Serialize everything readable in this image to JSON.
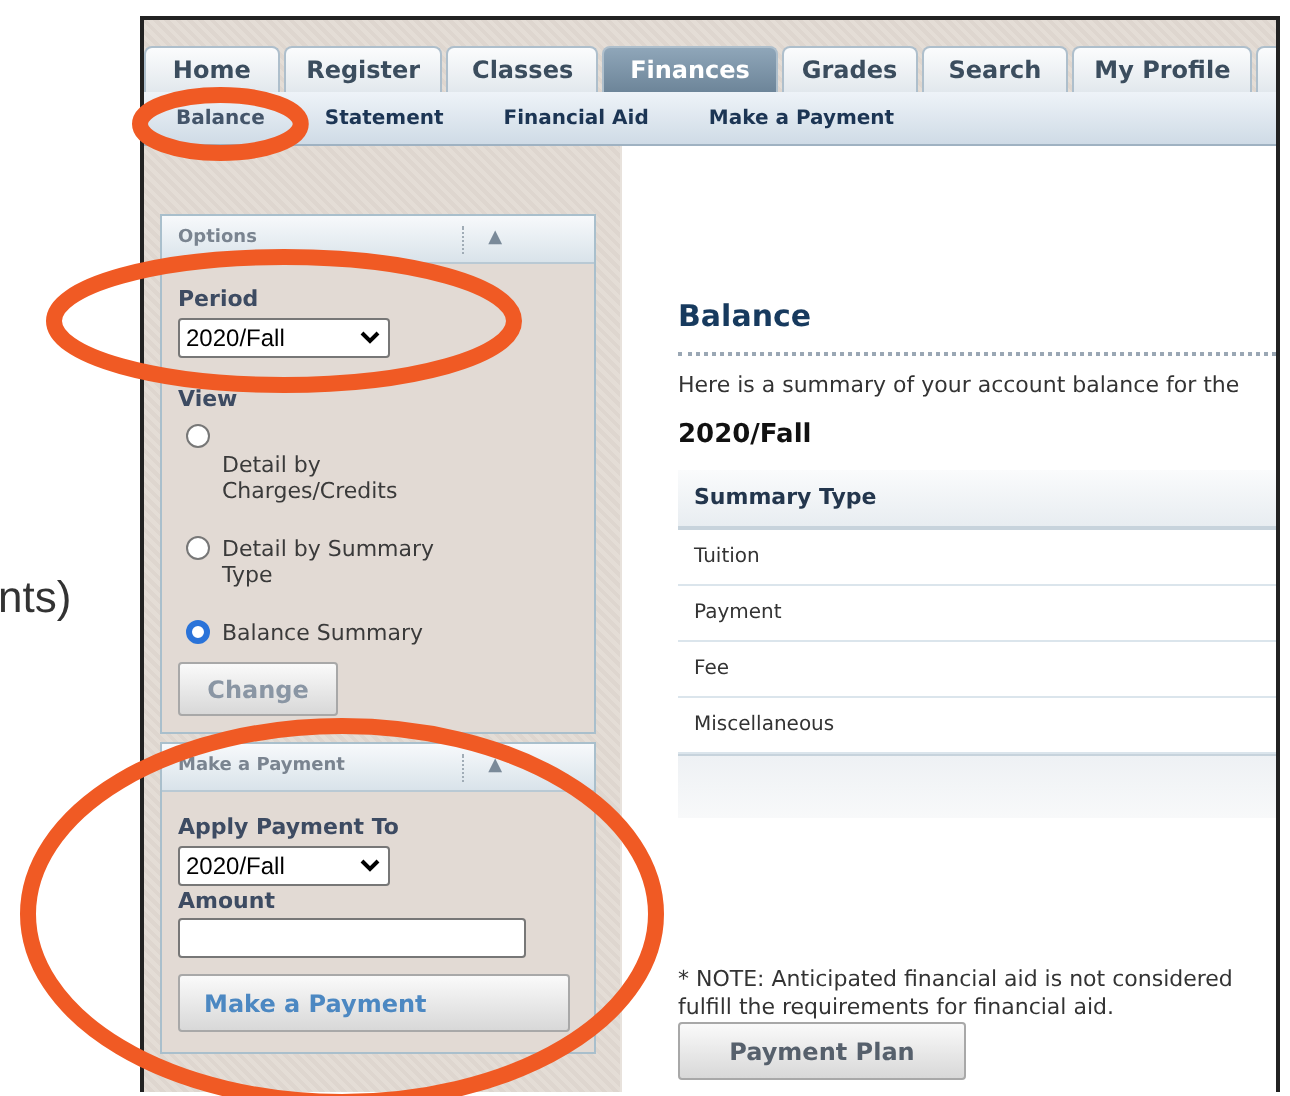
{
  "side_text": "nts)",
  "tabs": [
    {
      "label": "Home",
      "selected": false
    },
    {
      "label": "Register",
      "selected": false
    },
    {
      "label": "Classes",
      "selected": false
    },
    {
      "label": "Finances",
      "selected": true
    },
    {
      "label": "Grades",
      "selected": false
    },
    {
      "label": "Search",
      "selected": false
    },
    {
      "label": "My Profile",
      "selected": false
    }
  ],
  "subnav": [
    {
      "label": "Balance",
      "selected": true,
      "circled": true
    },
    {
      "label": "Statement",
      "selected": false,
      "circled": false
    },
    {
      "label": "Financial Aid",
      "selected": false,
      "circled": false
    },
    {
      "label": "Make a Payment",
      "selected": false,
      "circled": false
    }
  ],
  "options_panel": {
    "title": "Options",
    "collapse": "▲",
    "period_label": "Period",
    "period_value": "2020/Fall",
    "period_circled": true,
    "view_label": "View",
    "views": [
      {
        "label": "Detail by Charges/Credits",
        "selected": false
      },
      {
        "label": "Detail by Summary Type",
        "selected": false
      },
      {
        "label": "Balance Summary",
        "selected": true
      }
    ],
    "button": "Change"
  },
  "payment_panel": {
    "title": "Make a Payment",
    "collapse": "▲",
    "circled": true,
    "apply_label": "Apply Payment To",
    "apply_value": "2020/Fall",
    "amount_label": "Amount",
    "button": "Make a Payment"
  },
  "main": {
    "heading": "Balance",
    "intro": "Here is a summary of your account balance for the",
    "period": "2020/Fall",
    "table": {
      "columns": [
        "Summary Type"
      ],
      "rows": [
        [
          "Tuition"
        ],
        [
          "Payment"
        ],
        [
          "Fee"
        ],
        [
          "Miscellaneous"
        ]
      ]
    },
    "note_lines": [
      "* NOTE: Anticipated financial aid is not considered",
      "fulfill the requirements for financial aid."
    ],
    "button": "Payment Plan"
  }
}
